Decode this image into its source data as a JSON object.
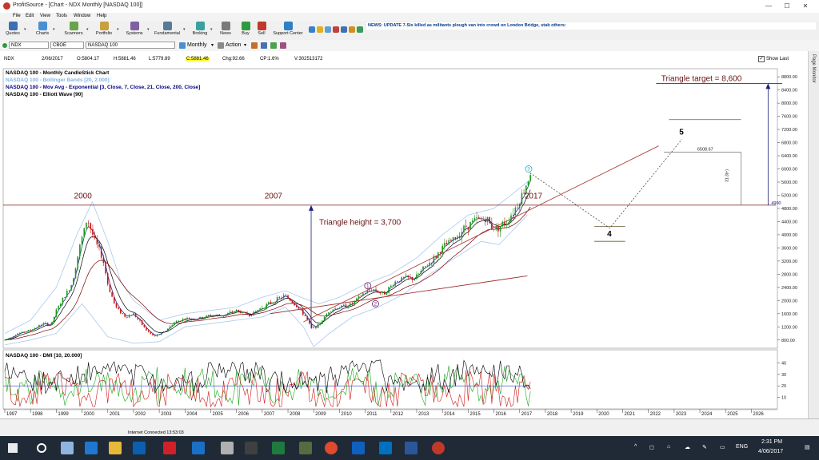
{
  "window": {
    "app": "ProfitSource",
    "title": "ProfitSource - [Chart - NDX Monthly [NASDAQ 100]]",
    "minimize": "—",
    "maximize": "☐",
    "close": "✕"
  },
  "menu": [
    "File",
    "Edit",
    "View",
    "Tools",
    "Window",
    "Help"
  ],
  "toolbar": {
    "buttons": [
      "Quotes",
      "Charts",
      "Scanners",
      "Portfolio",
      "Systems",
      "Fundamental",
      "Broking",
      "News",
      "Buy",
      "Sell",
      "Support Center"
    ]
  },
  "news_ticker": "NEWS: UPDATE 7-Six killed as militants plough van into crowd on London Bridge, stab others:",
  "symbol_bar": {
    "symbol": "NDX",
    "exchange": "CBOE",
    "name": "NASDAQ 100",
    "period": "Monthly",
    "action": "Action",
    "show_last_label": "Show Last"
  },
  "ohlc": {
    "symbol": "NDX",
    "date": "2/06/2017",
    "open": "O:5804.17",
    "high": "H:5881.46",
    "low": "L:5779.89",
    "close": "C:5881.46",
    "change": "Chg:92.66",
    "change_pct": "CP:1.6%",
    "volume": "V:302513172"
  },
  "chart_data": {
    "type": "candlestick",
    "legend": [
      {
        "text": "NASDAQ 100 - Monthly CandleStick Chart",
        "color": "#000000"
      },
      {
        "text": "NASDAQ 100 - Bollinger Bands [20, 2.000]",
        "color": "#7fb2e5"
      },
      {
        "text": "NASDAQ 100 - Mov Avg - Exponential [3, Close, 7, Close, 21, Close, 200, Close]",
        "color": "#00007f"
      },
      {
        "text": "NASDAQ 100 - Elliott Wave [90]",
        "color": "#000000"
      }
    ],
    "x_years": [
      "1997",
      "1998",
      "1999",
      "2000",
      "2001",
      "2002",
      "2003",
      "2004",
      "2005",
      "2006",
      "2007",
      "2008",
      "2009",
      "2010",
      "2011",
      "2012",
      "2013",
      "2014",
      "2015",
      "2016",
      "2017",
      "2018",
      "2019",
      "2020",
      "2021",
      "2022",
      "2023",
      "2024",
      "2025",
      "2026"
    ],
    "y_ticks": [
      800,
      1200,
      1600,
      2000,
      2400,
      2800,
      3200,
      3600,
      4000,
      4400,
      4800,
      5200,
      5600,
      6000,
      6400,
      6800,
      7200,
      7600,
      8000,
      8400,
      8800
    ],
    "ylim": [
      600,
      8950
    ],
    "price_path": [
      [
        1997.0,
        800
      ],
      [
        1997.5,
        1000
      ],
      [
        1998.0,
        1100
      ],
      [
        1998.5,
        1300
      ],
      [
        1998.8,
        1250
      ],
      [
        1999.0,
        1700
      ],
      [
        1999.3,
        2100
      ],
      [
        1999.6,
        2500
      ],
      [
        1999.9,
        3600
      ],
      [
        2000.2,
        4500
      ],
      [
        2000.5,
        3800
      ],
      [
        2000.8,
        3300
      ],
      [
        2001.0,
        2500
      ],
      [
        2001.3,
        1800
      ],
      [
        2001.7,
        1500
      ],
      [
        2002.0,
        1600
      ],
      [
        2002.5,
        1100
      ],
      [
        2002.8,
        900
      ],
      [
        2003.2,
        1050
      ],
      [
        2003.6,
        1350
      ],
      [
        2004.0,
        1450
      ],
      [
        2004.5,
        1450
      ],
      [
        2005.0,
        1550
      ],
      [
        2005.5,
        1550
      ],
      [
        2006.0,
        1700
      ],
      [
        2006.5,
        1550
      ],
      [
        2007.0,
        1800
      ],
      [
        2007.5,
        2000
      ],
      [
        2007.9,
        2150
      ],
      [
        2008.3,
        1850
      ],
      [
        2008.7,
        1500
      ],
      [
        2008.9,
        1150
      ],
      [
        2009.2,
        1250
      ],
      [
        2009.6,
        1700
      ],
      [
        2010.0,
        1800
      ],
      [
        2010.5,
        1900
      ],
      [
        2010.9,
        2200
      ],
      [
        2011.3,
        2350
      ],
      [
        2011.7,
        2200
      ],
      [
        2012.2,
        2600
      ],
      [
        2012.6,
        2700
      ],
      [
        2012.9,
        2650
      ],
      [
        2013.3,
        3000
      ],
      [
        2013.7,
        3300
      ],
      [
        2014.0,
        3600
      ],
      [
        2014.5,
        3900
      ],
      [
        2014.9,
        4250
      ],
      [
        2015.3,
        4450
      ],
      [
        2015.7,
        4500
      ],
      [
        2015.9,
        4250
      ],
      [
        2016.1,
        4200
      ],
      [
        2016.5,
        4400
      ],
      [
        2016.9,
        4900
      ],
      [
        2017.2,
        5400
      ],
      [
        2017.4,
        5881
      ]
    ],
    "bb_upper": [
      [
        1997,
        1000
      ],
      [
        1998,
        1400
      ],
      [
        1999,
        2400
      ],
      [
        1999.8,
        4000
      ],
      [
        2000.4,
        5000
      ],
      [
        2001,
        3800
      ],
      [
        2001.5,
        2600
      ],
      [
        2002,
        2000
      ],
      [
        2003,
        1400
      ],
      [
        2004,
        1600
      ],
      [
        2005,
        1700
      ],
      [
        2006,
        1800
      ],
      [
        2007,
        2100
      ],
      [
        2007.9,
        2300
      ],
      [
        2008.5,
        2100
      ],
      [
        2009.2,
        1900
      ],
      [
        2010,
        2100
      ],
      [
        2011,
        2500
      ],
      [
        2012,
        2800
      ],
      [
        2013,
        3300
      ],
      [
        2014,
        4000
      ],
      [
        2015,
        4600
      ],
      [
        2016,
        4800
      ],
      [
        2017.3,
        5600
      ]
    ],
    "bb_lower": [
      [
        1997,
        650
      ],
      [
        1998,
        800
      ],
      [
        1999,
        1000
      ],
      [
        2000,
        1900
      ],
      [
        2001,
        900
      ],
      [
        2002,
        700
      ],
      [
        2003,
        750
      ],
      [
        2004,
        1200
      ],
      [
        2005,
        1300
      ],
      [
        2006,
        1400
      ],
      [
        2007,
        1500
      ],
      [
        2007.9,
        1800
      ],
      [
        2008.6,
        1200
      ],
      [
        2009,
        600
      ],
      [
        2009.6,
        1000
      ],
      [
        2010.5,
        1500
      ],
      [
        2011.5,
        1800
      ],
      [
        2012.5,
        2200
      ],
      [
        2013.5,
        2800
      ],
      [
        2014.5,
        3300
      ],
      [
        2015.5,
        3800
      ],
      [
        2016.2,
        3700
      ],
      [
        2017.3,
        4600
      ]
    ],
    "triangle_line_y": 4900,
    "year_labels": [
      {
        "text": "2000",
        "x": 2000.0,
        "y": 5100
      },
      {
        "text": "2007",
        "x": 2007.4,
        "y": 5100
      },
      {
        "text": "2017",
        "x": 2017.5,
        "y": 5100
      }
    ],
    "annotations": {
      "triangle_height": "Triangle height = 3,700",
      "triangle_target": "Triangle target = 8,600",
      "wave_4": "4",
      "wave_5": "5",
      "wave_1": "1",
      "wave_2": "2",
      "wave_3": "3",
      "level_4900": "4900",
      "level_6508": "6508.67",
      "pct_label": "31.3(+)"
    },
    "dmi": {
      "label": "NASDAQ 100 - DMI [10, 20.000]",
      "y_ticks": [
        10,
        20,
        30,
        40
      ],
      "ylim": [
        0,
        50
      ]
    }
  },
  "status": "Internet Connected 13:53:03",
  "taskbar": {
    "time": "2:31 PM",
    "date": "4/06/2017",
    "lang": "ENG"
  }
}
